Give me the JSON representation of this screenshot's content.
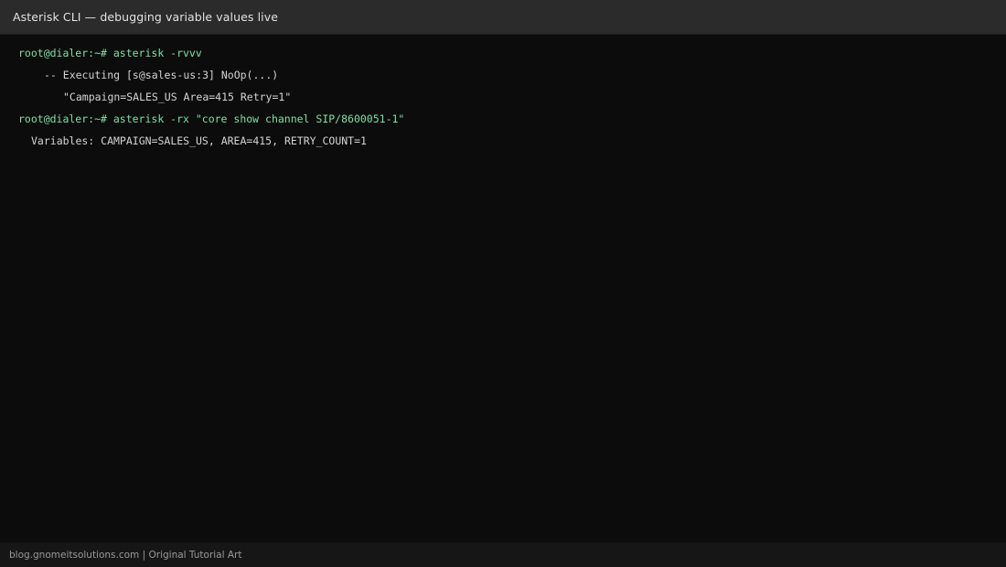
{
  "window": {
    "title": "Asterisk CLI — debugging variable values live"
  },
  "terminal": {
    "lines": [
      {
        "text": "root@dialer:~# asterisk -rvvv",
        "kind": "prompt"
      },
      {
        "text": "-- Executing [s@sales-us:3] NoOp(...)",
        "kind": "output"
      },
      {
        "text": "\"Campaign=SALES_US Area=415 Retry=1\"",
        "kind": "output"
      },
      {
        "text": "root@dialer:~# asterisk -rx \"core show channel SIP/8600051-1\"",
        "kind": "prompt"
      },
      {
        "text": "Variables: CAMPAIGN=SALES_US, AREA=415, RETRY_COUNT=1",
        "kind": "output"
      }
    ],
    "colors": {
      "prompt": "#7ee0a4",
      "output": "#d4d4d4",
      "background": "#0c0c0c"
    }
  },
  "footer": {
    "text": "blog.gnomeitsolutions.com | Original Tutorial Art"
  }
}
